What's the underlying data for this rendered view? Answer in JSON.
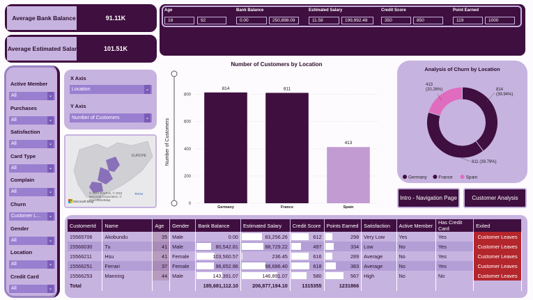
{
  "kpis": [
    {
      "label": "Average Bank Balance",
      "value": "91.11K"
    },
    {
      "label": "Average Estimated Salary",
      "value": "101.51K"
    }
  ],
  "range_slicers": [
    {
      "title": "Age",
      "min": "18",
      "max": "92"
    },
    {
      "title": "Bank Balance",
      "min": "0.00",
      "max": "250,898.09"
    },
    {
      "title": "Estimated Salary",
      "min": "11.58",
      "max": "199,992.48"
    },
    {
      "title": "Credit Score",
      "min": "350",
      "max": "850"
    },
    {
      "title": "Point Earned",
      "min": "119",
      "max": "1000"
    }
  ],
  "filters": [
    {
      "title": "Active Member",
      "value": "All"
    },
    {
      "title": "Purchases",
      "value": "All"
    },
    {
      "title": "Satisfaction",
      "value": "All"
    },
    {
      "title": "Card Type",
      "value": "All"
    },
    {
      "title": "Complain",
      "value": "All"
    },
    {
      "title": "Churn",
      "value": "Customer L..."
    },
    {
      "title": "Gender",
      "value": "All"
    },
    {
      "title": "Location",
      "value": "All"
    },
    {
      "title": "Credit Card",
      "value": "All"
    }
  ],
  "axis_panel": {
    "x_title": "X Axis",
    "x_value": "Location",
    "y_title": "Y Axis",
    "y_value": "Number of Customers"
  },
  "map": {
    "label": "EUROPE",
    "attribution": "© 2024 TomTom, © 2024 Microsoft Corporation, © OpenStreetMap",
    "terms": "Terms",
    "brand": "Microsoft Bing"
  },
  "chart_data": [
    {
      "type": "bar",
      "title": "Number of Customers by Location",
      "xlabel": "",
      "ylabel": "Number of Customers",
      "categories": [
        "Germany",
        "France",
        "Spain"
      ],
      "values": [
        814,
        811,
        413
      ],
      "data_labels": [
        "814",
        "811",
        "413"
      ],
      "ylim": [
        0,
        900
      ],
      "yticks": [
        0,
        200,
        400,
        600,
        800
      ],
      "highlighted": [
        true,
        true,
        false
      ],
      "colors": {
        "highlight": "#3f0f3f",
        "muted": "#c39bd3"
      }
    },
    {
      "type": "pie",
      "title": "Analysis of Churn by Location",
      "categories": [
        "Germany",
        "France",
        "Spain"
      ],
      "values": [
        814,
        811,
        413
      ],
      "labels": [
        "814\n(39.94%)",
        "811 (39.79%)",
        "413\n(20.26%)"
      ],
      "colors": [
        "#3f0f3f",
        "#3f0f3f",
        "#e06cbf"
      ],
      "legend_position": "bottom"
    }
  ],
  "buttons": {
    "nav": "Intro - Navigation Page",
    "analysis": "Customer Analysis"
  },
  "table": {
    "columns": [
      "CustomerId",
      "Name",
      "Age",
      "Gender",
      "Bank Balance",
      "Estimated Salary",
      "Credit Score",
      "Points Earned",
      "Satisfaction",
      "Active Member",
      "Has Credit Card",
      "Exited"
    ],
    "rows": [
      [
        "15565706",
        "Akobundu",
        "35",
        "Male",
        "0.00",
        "83,256.26",
        "612",
        "298",
        "Very Low",
        "Yes",
        "Yes",
        "Customer Leaves"
      ],
      [
        "15566030",
        "Tu",
        "41",
        "Male",
        "80,542.81",
        "88,729.22",
        "497",
        "334",
        "Low",
        "No",
        "Yes",
        "Customer Leaves"
      ],
      [
        "15566211",
        "Hsu",
        "41",
        "Female",
        "103,560.57",
        "236.45",
        "616",
        "289",
        "Average",
        "No",
        "Yes",
        "Customer Leaves"
      ],
      [
        "15566251",
        "Ferrari",
        "37",
        "Female",
        "96,652.86",
        "98,686.40",
        "618",
        "383",
        "Average",
        "No",
        "Yes",
        "Customer Leaves"
      ],
      [
        "15566253",
        "Manning",
        "44",
        "Male",
        "143,391.07",
        "146,891.07",
        "580",
        "567",
        "High",
        "No",
        "No",
        "Customer Leaves"
      ]
    ],
    "bank_fill": [
      0.0,
      0.32,
      0.41,
      0.39,
      0.57
    ],
    "salary_fill": [
      0.42,
      0.44,
      0.01,
      0.49,
      0.73
    ],
    "score_fill": [
      0.52,
      0.29,
      0.53,
      0.54,
      0.46
    ],
    "points_fill": [
      0.2,
      0.24,
      0.19,
      0.3,
      0.51
    ],
    "total": {
      "label": "Total",
      "bank": "185,681,112.10",
      "salary": "206,877,194.10",
      "score": "1315355",
      "points": "1231866"
    }
  }
}
